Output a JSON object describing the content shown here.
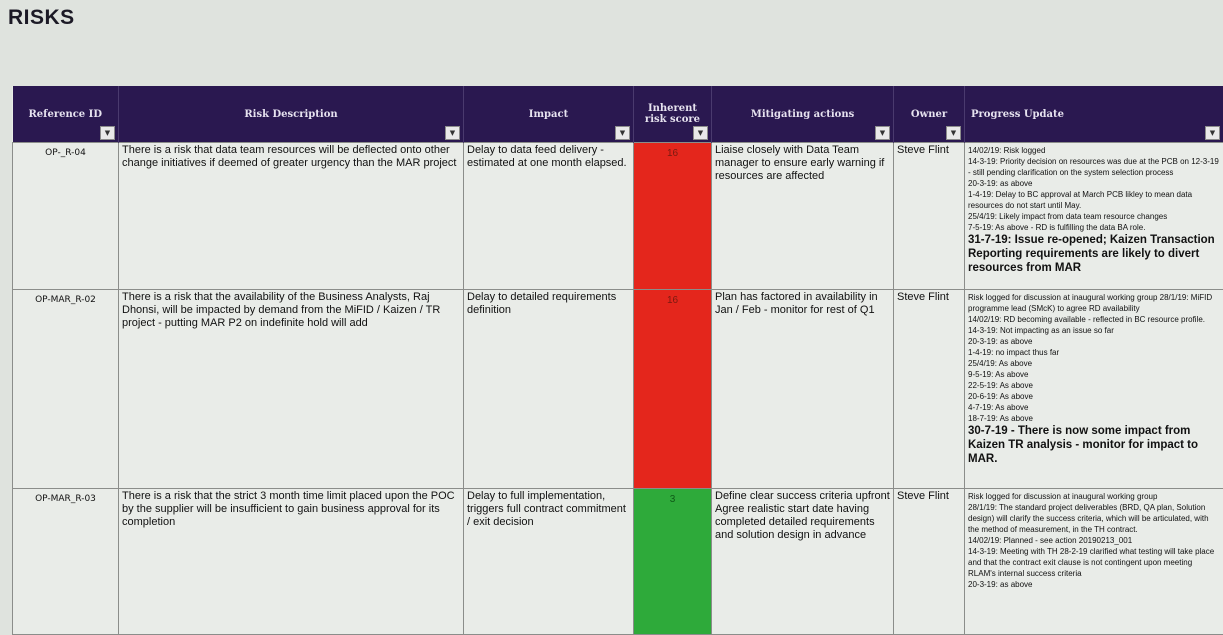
{
  "page": {
    "title": "RISKS"
  },
  "table": {
    "headers": {
      "ref": "Reference ID",
      "description": "Risk Description",
      "impact": "Impact",
      "score": "Inherent risk score",
      "mitigation": "Mitigating actions",
      "owner": "Owner",
      "progress": "Progress Update"
    },
    "filter_icon": "dropdown-arrow",
    "colors": {
      "header_bg": "#2a1850",
      "score_high": "#e4261c",
      "score_low": "#2eaa3a"
    },
    "rows": [
      {
        "ref": "OP-_R-04",
        "description": "There is a risk that data team resources will be deflected onto other change initiatives if deemed of greater urgency than the MAR project",
        "impact": "Delay to data feed delivery - estimated at one month elapsed.",
        "score": "16",
        "score_level": "high",
        "mitigation": "Liaise closely with Data Team manager to ensure early warning if resources are affected",
        "owner": "Steve Flint",
        "progress": [
          "14/02/19: Risk logged",
          "14-3-19: Priority decision on resources was due at the PCB on 12-3-19 - still pending clarification on the system selection process",
          "20-3-19: as above",
          "1-4-19: Delay to BC approval at March PCB likley to mean data resources do not start until May.",
          "25/4/19: Likely impact from data team resource changes",
          "7-5-19: As above - RD is fulfilling the data BA role."
        ],
        "progress_highlight": "31-7-19: Issue re-opened; Kaizen Transaction Reporting requirements are likely to divert resources from MAR"
      },
      {
        "ref": "OP-MAR_R-02",
        "description": "There is a risk that the availability of the Business Analysts, Raj Dhonsi, will be impacted by demand from the MiFID / Kaizen / TR project - putting MAR P2 on indefinite hold will add",
        "impact": "Delay to detailed requirements definition",
        "score": "16",
        "score_level": "high",
        "mitigation": "Plan has factored in availability in Jan / Feb - monitor for rest of Q1",
        "owner": "Steve Flint",
        "progress": [
          "Risk logged for discussion at inaugural working group 28/1/19: MiFID programme lead (SMcK) to agree RD availability",
          "14/02/19: RD becoming available - reflected in BC resource profile.",
          "14-3-19: Not impacting as an issue so far",
          "20-3-19: as above",
          "1-4-19: no impact thus far",
          "25/4/19: As above",
          "9-5-19: As above",
          "22-5-19: As above",
          "20-6-19: As above",
          "4-7-19: As above",
          "18-7-19: As above"
        ],
        "progress_highlight": "30-7-19 - There is now some impact from Kaizen TR analysis  - monitor for impact to MAR."
      },
      {
        "ref": "OP-MAR_R-03",
        "description": "There is a risk that the strict 3 month time limit placed upon the POC by the supplier will be insufficient to gain business approval for its completion",
        "impact": "Delay to full implementation, triggers full contract commitment / exit decision",
        "score": "3",
        "score_level": "low",
        "mitigation": "Define clear success criteria upfront\nAgree realistic start date having completed detailed requirements and solution design in advance",
        "owner": "Steve Flint",
        "progress": [
          "Risk logged for discussion at inaugural working group",
          "28/1/19: The standard project deliverables (BRD, QA plan, Solution design) will clarify the success criteria, which will be articulated, with the method of measurement, in the TH contract.",
          "14/02/19: Planned - see action 20190213_001",
          "14-3-19: Meeting with TH 28-2-19 clarified what testing will take place and that the contract exit clause is not contingent upon meeting RLAM's internal success criteria",
          "20-3-19: as above"
        ],
        "progress_highlight": ""
      }
    ]
  }
}
